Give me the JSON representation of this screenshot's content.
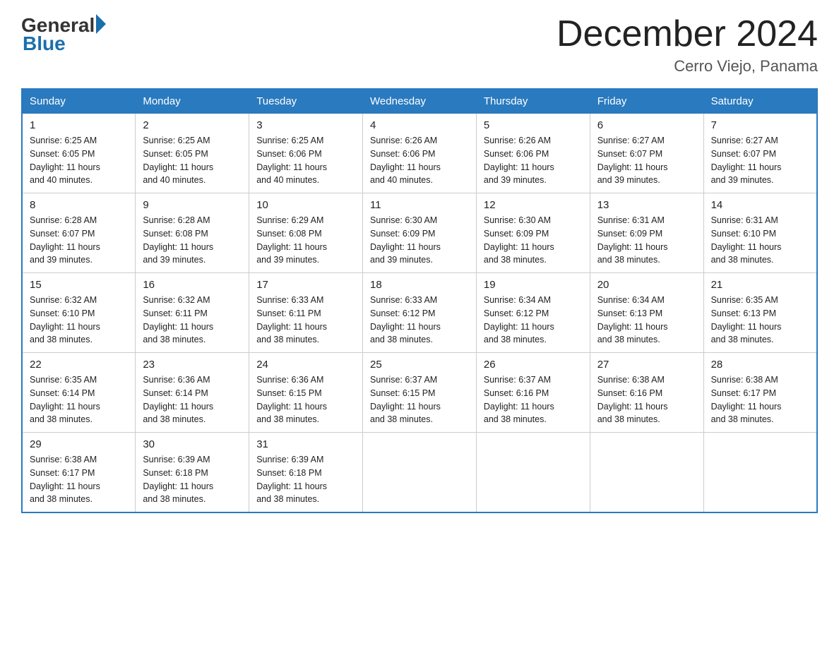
{
  "header": {
    "logo_general": "General",
    "logo_blue": "Blue",
    "title": "December 2024",
    "location": "Cerro Viejo, Panama"
  },
  "days_of_week": [
    "Sunday",
    "Monday",
    "Tuesday",
    "Wednesday",
    "Thursday",
    "Friday",
    "Saturday"
  ],
  "weeks": [
    [
      {
        "day": "1",
        "sunrise": "6:25 AM",
        "sunset": "6:05 PM",
        "daylight": "11 hours and 40 minutes."
      },
      {
        "day": "2",
        "sunrise": "6:25 AM",
        "sunset": "6:05 PM",
        "daylight": "11 hours and 40 minutes."
      },
      {
        "day": "3",
        "sunrise": "6:25 AM",
        "sunset": "6:06 PM",
        "daylight": "11 hours and 40 minutes."
      },
      {
        "day": "4",
        "sunrise": "6:26 AM",
        "sunset": "6:06 PM",
        "daylight": "11 hours and 40 minutes."
      },
      {
        "day": "5",
        "sunrise": "6:26 AM",
        "sunset": "6:06 PM",
        "daylight": "11 hours and 39 minutes."
      },
      {
        "day": "6",
        "sunrise": "6:27 AM",
        "sunset": "6:07 PM",
        "daylight": "11 hours and 39 minutes."
      },
      {
        "day": "7",
        "sunrise": "6:27 AM",
        "sunset": "6:07 PM",
        "daylight": "11 hours and 39 minutes."
      }
    ],
    [
      {
        "day": "8",
        "sunrise": "6:28 AM",
        "sunset": "6:07 PM",
        "daylight": "11 hours and 39 minutes."
      },
      {
        "day": "9",
        "sunrise": "6:28 AM",
        "sunset": "6:08 PM",
        "daylight": "11 hours and 39 minutes."
      },
      {
        "day": "10",
        "sunrise": "6:29 AM",
        "sunset": "6:08 PM",
        "daylight": "11 hours and 39 minutes."
      },
      {
        "day": "11",
        "sunrise": "6:30 AM",
        "sunset": "6:09 PM",
        "daylight": "11 hours and 39 minutes."
      },
      {
        "day": "12",
        "sunrise": "6:30 AM",
        "sunset": "6:09 PM",
        "daylight": "11 hours and 38 minutes."
      },
      {
        "day": "13",
        "sunrise": "6:31 AM",
        "sunset": "6:09 PM",
        "daylight": "11 hours and 38 minutes."
      },
      {
        "day": "14",
        "sunrise": "6:31 AM",
        "sunset": "6:10 PM",
        "daylight": "11 hours and 38 minutes."
      }
    ],
    [
      {
        "day": "15",
        "sunrise": "6:32 AM",
        "sunset": "6:10 PM",
        "daylight": "11 hours and 38 minutes."
      },
      {
        "day": "16",
        "sunrise": "6:32 AM",
        "sunset": "6:11 PM",
        "daylight": "11 hours and 38 minutes."
      },
      {
        "day": "17",
        "sunrise": "6:33 AM",
        "sunset": "6:11 PM",
        "daylight": "11 hours and 38 minutes."
      },
      {
        "day": "18",
        "sunrise": "6:33 AM",
        "sunset": "6:12 PM",
        "daylight": "11 hours and 38 minutes."
      },
      {
        "day": "19",
        "sunrise": "6:34 AM",
        "sunset": "6:12 PM",
        "daylight": "11 hours and 38 minutes."
      },
      {
        "day": "20",
        "sunrise": "6:34 AM",
        "sunset": "6:13 PM",
        "daylight": "11 hours and 38 minutes."
      },
      {
        "day": "21",
        "sunrise": "6:35 AM",
        "sunset": "6:13 PM",
        "daylight": "11 hours and 38 minutes."
      }
    ],
    [
      {
        "day": "22",
        "sunrise": "6:35 AM",
        "sunset": "6:14 PM",
        "daylight": "11 hours and 38 minutes."
      },
      {
        "day": "23",
        "sunrise": "6:36 AM",
        "sunset": "6:14 PM",
        "daylight": "11 hours and 38 minutes."
      },
      {
        "day": "24",
        "sunrise": "6:36 AM",
        "sunset": "6:15 PM",
        "daylight": "11 hours and 38 minutes."
      },
      {
        "day": "25",
        "sunrise": "6:37 AM",
        "sunset": "6:15 PM",
        "daylight": "11 hours and 38 minutes."
      },
      {
        "day": "26",
        "sunrise": "6:37 AM",
        "sunset": "6:16 PM",
        "daylight": "11 hours and 38 minutes."
      },
      {
        "day": "27",
        "sunrise": "6:38 AM",
        "sunset": "6:16 PM",
        "daylight": "11 hours and 38 minutes."
      },
      {
        "day": "28",
        "sunrise": "6:38 AM",
        "sunset": "6:17 PM",
        "daylight": "11 hours and 38 minutes."
      }
    ],
    [
      {
        "day": "29",
        "sunrise": "6:38 AM",
        "sunset": "6:17 PM",
        "daylight": "11 hours and 38 minutes."
      },
      {
        "day": "30",
        "sunrise": "6:39 AM",
        "sunset": "6:18 PM",
        "daylight": "11 hours and 38 minutes."
      },
      {
        "day": "31",
        "sunrise": "6:39 AM",
        "sunset": "6:18 PM",
        "daylight": "11 hours and 38 minutes."
      },
      null,
      null,
      null,
      null
    ]
  ],
  "labels": {
    "sunrise": "Sunrise:",
    "sunset": "Sunset:",
    "daylight": "Daylight:"
  },
  "colors": {
    "header_bg": "#2a7abf",
    "accent": "#1a6fad"
  }
}
